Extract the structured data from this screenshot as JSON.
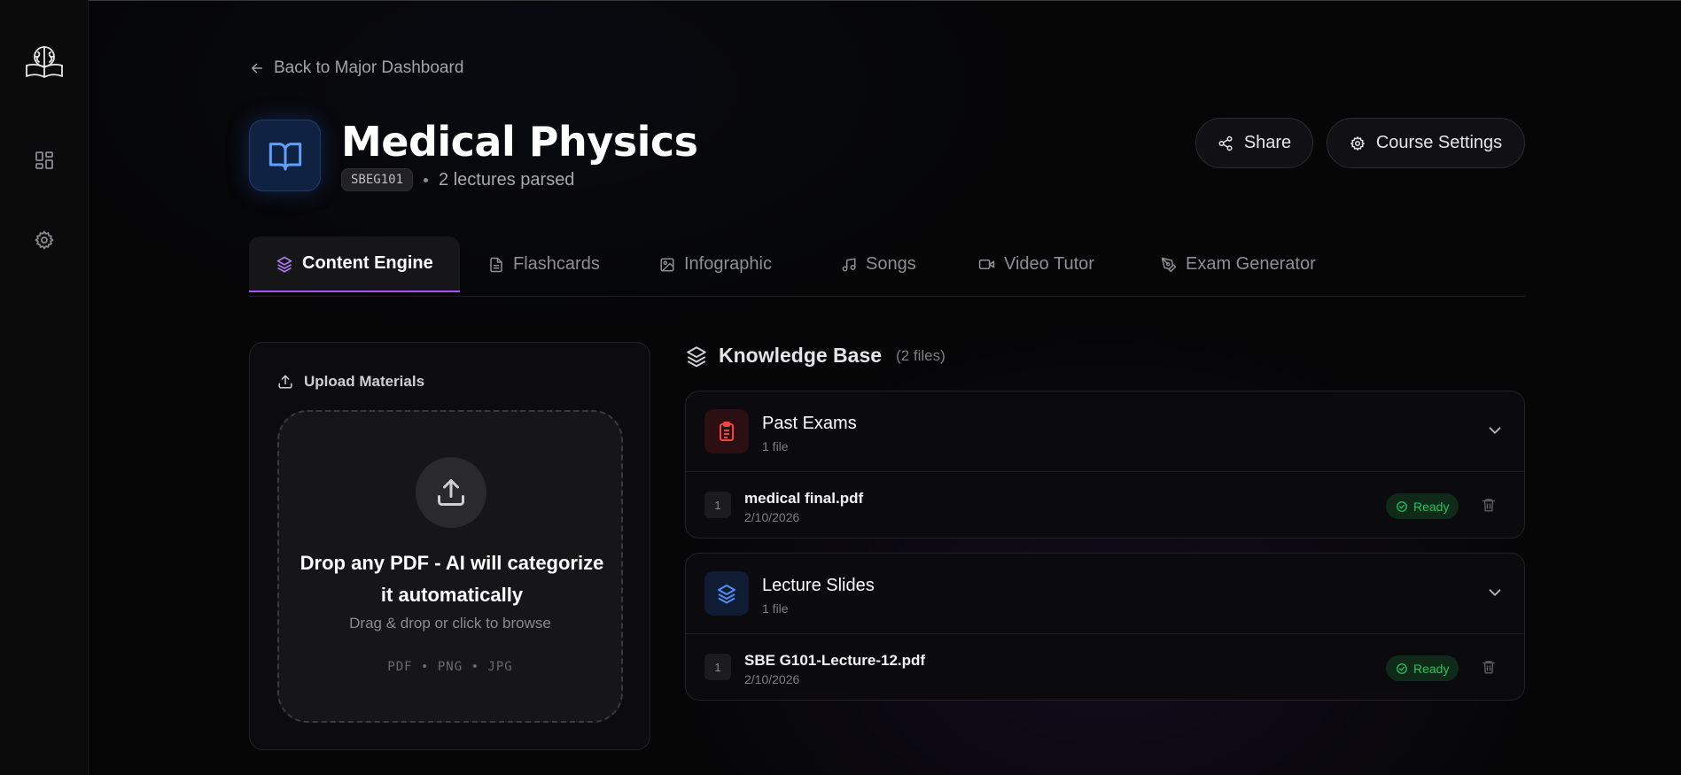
{
  "sidebar": {
    "logo_icon": "brain-book-logo-icon",
    "items": [
      {
        "icon": "dashboard-grid-icon"
      },
      {
        "icon": "gear-icon"
      }
    ]
  },
  "back_link": {
    "label": "Back to Major Dashboard",
    "icon": "arrow-left-icon"
  },
  "course": {
    "icon": "open-book-icon",
    "title": "Medical Physics",
    "code": "SBEG101",
    "lectures": "2 lectures parsed"
  },
  "header_actions": {
    "share_label": "Share",
    "settings_label": "Course Settings"
  },
  "tabs": [
    {
      "label": "Content Engine",
      "icon": "layers-icon",
      "active": true
    },
    {
      "label": "Flashcards",
      "icon": "document-icon"
    },
    {
      "label": "Infographic",
      "icon": "image-icon"
    },
    {
      "label": "Songs",
      "icon": "music-note-icon"
    },
    {
      "label": "Video Tutor",
      "icon": "video-camera-icon"
    },
    {
      "label": "Exam Generator",
      "icon": "pen-tool-icon"
    }
  ],
  "upload": {
    "heading": "Upload Materials",
    "drop_title": "Drop any PDF - AI will categorize it automatically",
    "drop_subtitle": "Drag & drop or click to browse",
    "file_types": "PDF • PNG • JPG"
  },
  "knowledge_base": {
    "title": "Knowledge Base",
    "count": "(2 files)",
    "groups": [
      {
        "title": "Past Exams",
        "subtitle": "1 file",
        "icon": "clipboard-list-icon",
        "accent": "#ef4444",
        "files": [
          {
            "index": "1",
            "name": "medical final.pdf",
            "date": "2/10/2026",
            "status": "Ready"
          }
        ]
      },
      {
        "title": "Lecture Slides",
        "subtitle": "1 file",
        "icon": "layers-icon",
        "accent": "#4f8ff5",
        "files": [
          {
            "index": "1",
            "name": "SBE G101-Lecture-12.pdf",
            "date": "2/10/2026",
            "status": "Ready"
          }
        ]
      }
    ]
  },
  "colors": {
    "background": "#060607",
    "accent_purple": "#a855f7",
    "ready_green": "#22c55e",
    "course_blue": "#5fa0ff"
  }
}
